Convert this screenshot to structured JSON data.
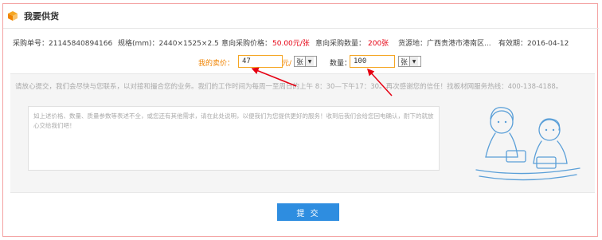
{
  "header": {
    "title": "我要供货"
  },
  "info": {
    "order_no": "采购单号：21145840894166",
    "spec": "规格(mm)：2440×1525×2.5",
    "intent_price_label": "意向采购价格：",
    "intent_price_value": "50.00元/张",
    "intent_qty_label": "意向采购数量：",
    "intent_qty_value": "200张",
    "origin": "货源地：广西贵港市港南区...",
    "valid_until": "有效期：2016-04-12"
  },
  "quote": {
    "price_label": "我的卖价：",
    "price_value": "47",
    "price_unit": "元/",
    "price_unit_select": "张",
    "qty_label": "数量：",
    "qty_value": "100",
    "qty_unit_select": "张"
  },
  "notice": "请放心提交，我们会尽快与您联系，以对接和撮合您的业务。我们的工作时间为每周一至周日的上午 8：30—下午17：30。再次感谢您的信任！找板材网服务热线：400-138-4188。",
  "message": {
    "placeholder": "如上述价格、数量、质量参数等表述不全，或您还有其他需求，请在此处说明，以便我们为您提供更好的服务！收到后我们会给您回电确认，耐下的就放心交给我们吧！"
  },
  "submit_label": "提 交",
  "colors": {
    "accent": "#f08300",
    "primary_button": "#2e8de0",
    "red": "#e60012",
    "frame_border": "#f4a3a3"
  },
  "icons": {
    "title_icon": "box-icon",
    "select_arrow": "chevron-down-icon"
  }
}
